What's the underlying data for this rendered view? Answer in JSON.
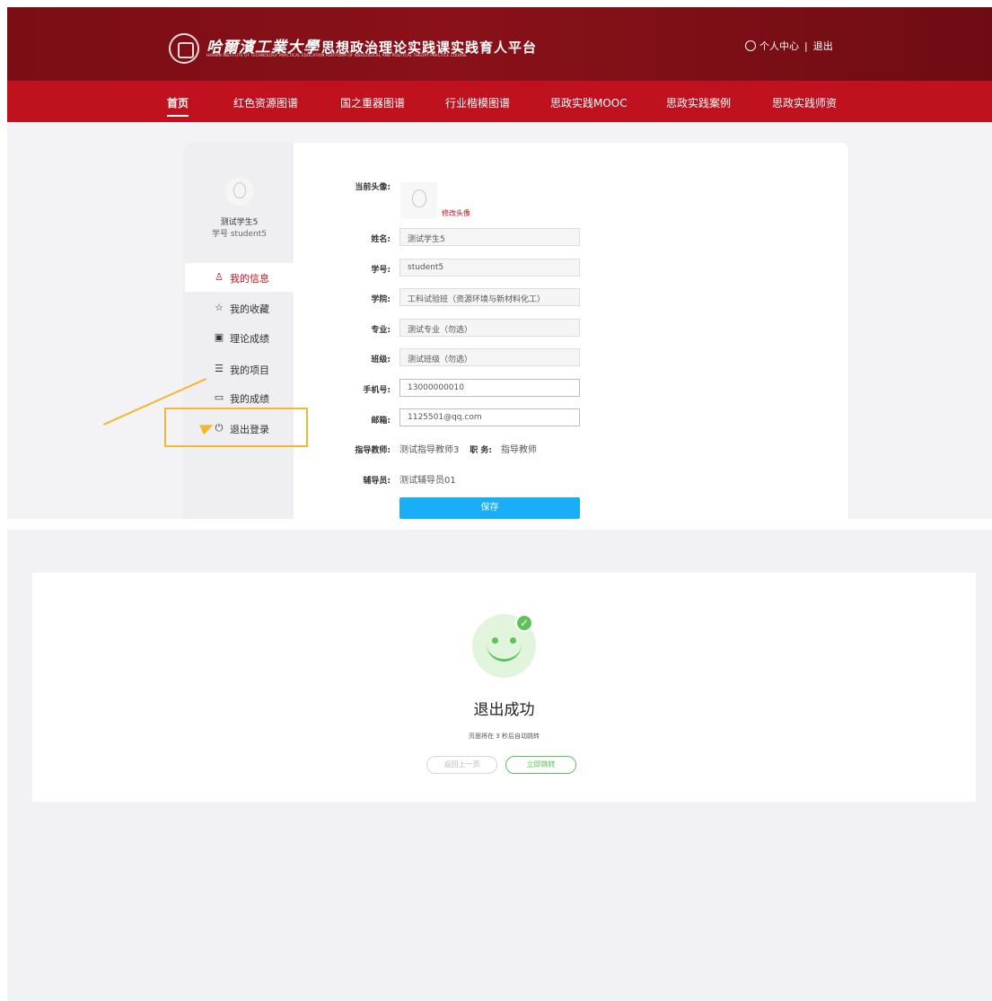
{
  "header": {
    "school_name": "哈爾濱工業大學",
    "platform_name": "思想政治理论实践课实践育人平台",
    "english_name": "HARBIN INSTITUTE OF TECHNOLOGY PRACTICAL EDUCATION PLATFORM OF IDEOLOGICAL AND POLITICAL THEORY PRACTICE COURSE",
    "personal_center": "个人中心",
    "separator": "|",
    "logout": "退出"
  },
  "nav": {
    "items": [
      {
        "label": "首页"
      },
      {
        "label": "红色资源图谱"
      },
      {
        "label": "国之重器图谱"
      },
      {
        "label": "行业楷模图谱"
      },
      {
        "label": "思政实践MOOC"
      },
      {
        "label": "思政实践案例"
      },
      {
        "label": "思政实践师资"
      }
    ]
  },
  "profile": {
    "name": "测试学生5",
    "student_id_line": "学号 student5"
  },
  "sidebar_menu": [
    {
      "label": "我的信息",
      "icon": "user-icon"
    },
    {
      "label": "我的收藏",
      "icon": "star-icon"
    },
    {
      "label": "理论成绩",
      "icon": "video-icon"
    },
    {
      "label": "我的项目",
      "icon": "list-icon"
    },
    {
      "label": "我的成绩",
      "icon": "folder-icon"
    },
    {
      "label": "退出登录",
      "icon": "power-icon"
    }
  ],
  "form": {
    "avatar_label": "当前头像:",
    "change_avatar": "修改头像",
    "name_label": "姓名:",
    "name_value": "测试学生5",
    "id_label": "学号:",
    "id_value": "student5",
    "college_label": "学院:",
    "college_value": "工科试验班（资源环境与新材料化工）",
    "major_label": "专业:",
    "major_value": "测试专业（勿选）",
    "class_label": "班级:",
    "class_value": "测试班级（勿选）",
    "phone_label": "手机号:",
    "phone_value": "13000000010",
    "email_label": "邮箱:",
    "email_value": "1125501@qq.com",
    "teacher_label": "指导教师:",
    "teacher_value": "测试指导教师3",
    "position_label": "职 务:",
    "position_value": "指导教师",
    "counselor_label": "辅导员:",
    "counselor_value": "测试辅导员01",
    "save_label": "保存"
  },
  "logout_result": {
    "title": "退出成功",
    "subtitle": "页面将在 3 秒后自动跳转",
    "back_label": "返回上一页",
    "jump_label": "立即跳转"
  },
  "colors": {
    "brand_dark": "#7b0d15",
    "nav_red": "#c0121e",
    "save_blue": "#19aef5",
    "success_green": "#5cc35a",
    "highlight_yellow": "#f5b731"
  }
}
